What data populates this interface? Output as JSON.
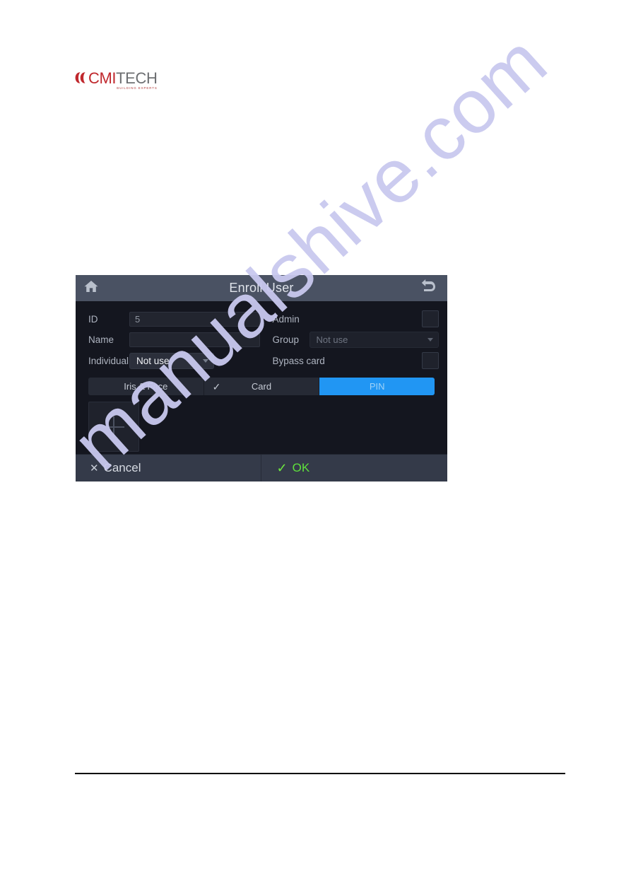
{
  "page": {
    "watermark_text": "manualshive.com",
    "rule": "horizontal-rule"
  },
  "logo": {
    "brand_cmi": "CMI",
    "brand_tech": "TECH",
    "tagline": "BUILDING EXPERTS",
    "mark": "double-chevron-mark",
    "color_red": "#c0282d",
    "color_grey": "#6d6f72"
  },
  "device": {
    "header": {
      "title": "Enroll User",
      "home_icon": "home-icon",
      "back_icon": "back-arrow-icon"
    },
    "form": {
      "left": {
        "id_label": "ID",
        "id_value": "5",
        "name_label": "Name",
        "name_value": "",
        "individual_label": "Individual",
        "individual_value": "Not use"
      },
      "right": {
        "admin_label": "Admin",
        "admin_checked": false,
        "group_label": "Group",
        "group_value": "Not use",
        "bypass_label": "Bypass card",
        "bypass_checked": false
      }
    },
    "tabs": [
      {
        "label": "Iris & Face",
        "active": false,
        "checkmark": ""
      },
      {
        "label": "Card",
        "active": false,
        "checkmark": "✓"
      },
      {
        "label": "PIN",
        "active": true,
        "checkmark": ""
      }
    ],
    "content": {
      "add_tile_icon": "plus-icon"
    },
    "footer": {
      "cancel_label": "Cancel",
      "cancel_icon": "✕",
      "ok_label": "OK",
      "ok_icon": "✓",
      "ok_color": "#5ee03c"
    },
    "colors": {
      "header_bg": "#4a5263",
      "body_bg": "#14161f",
      "footer_bg": "#343a49",
      "tab_active": "#2196f3"
    }
  }
}
